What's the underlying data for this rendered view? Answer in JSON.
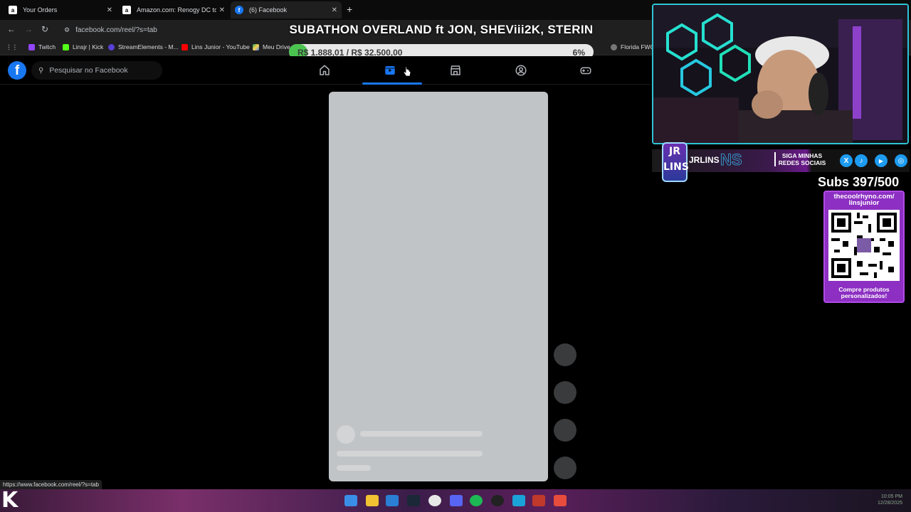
{
  "browser": {
    "tabs": [
      {
        "title": "Your Orders",
        "active": false
      },
      {
        "title": "Amazon.com: Renogy DC to DC",
        "active": false
      },
      {
        "title": "(6) Facebook",
        "active": true
      }
    ],
    "url": "facebook.com/reel/?s=tab",
    "bookmarks": [
      "Twitch",
      "Linsjr | Kick",
      "StreamElements - M...",
      "Lins Junior - YouTube",
      "Meu Drive",
      "Florida FWC"
    ],
    "status_url": "https://www.facebook.com/reel/?s=tab"
  },
  "overlay": {
    "title": "SUBATHON OVERLAND ft JON, SHEViii2K, STERIN",
    "goal_text": "R$ 1.888,01 / R$ 32.500,00",
    "goal_percent_label": "6%",
    "goal_fraction": 0.06,
    "subs": "Subs 397/500",
    "qr_url": "thecoolrhyno.com/ linsjunior",
    "qr_caption": "Compre produtos personalizados!",
    "brand": "JRLINS",
    "brand_ghost": "NS",
    "badge": "JR LINS",
    "social_caption": "SIGA MINHAS REDES SOCIAIS"
  },
  "facebook": {
    "logo": "f",
    "search_placeholder": "Pesquisar no Facebook",
    "nav": [
      {
        "name": "home-icon",
        "active": false
      },
      {
        "name": "reels-icon",
        "active": true
      },
      {
        "name": "marketplace-icon",
        "active": false
      },
      {
        "name": "groups-icon",
        "active": false
      },
      {
        "name": "gaming-icon",
        "active": false
      }
    ]
  },
  "colors": {
    "fb_blue": "#1877f2",
    "goal_green": "#4bc44f",
    "reel_placeholder": "#c1c4c7",
    "qr_purple": "#8c2fc2",
    "webcam_border": "#2ec4d6"
  },
  "taskbar": {
    "clock_time": "10:05 PM",
    "clock_date": "12/28/2025"
  }
}
